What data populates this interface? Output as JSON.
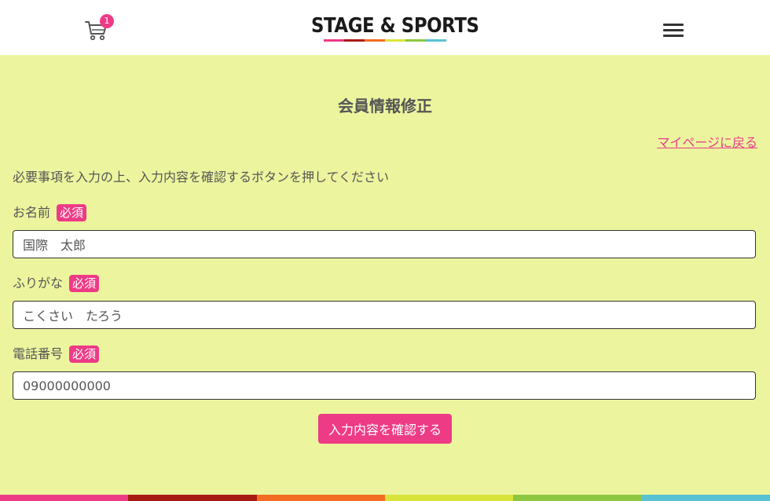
{
  "header": {
    "cart_count": "1",
    "logo_text": "STAGE & SPORTS",
    "brand_colors": [
      "#ee3b86",
      "#a61c12",
      "#f26c21",
      "#d9e43b",
      "#8dc63f",
      "#58c2d3"
    ]
  },
  "page": {
    "title": "会員情報修正",
    "back_link": "マイページに戻る",
    "instruction": "必要事項を入力の上、入力内容を確認するボタンを押してください"
  },
  "form": {
    "required_label": "必須",
    "fields": [
      {
        "label": "お名前",
        "value": "国際　太郎"
      },
      {
        "label": "ふりがな",
        "value": "こくさい　たろう"
      },
      {
        "label": "電話番号",
        "value": "09000000000"
      }
    ],
    "submit_label": "入力内容を確認する"
  },
  "colors": {
    "background": "#ecf59e",
    "accent": "#ee3b86",
    "link": "#e83e8c"
  }
}
